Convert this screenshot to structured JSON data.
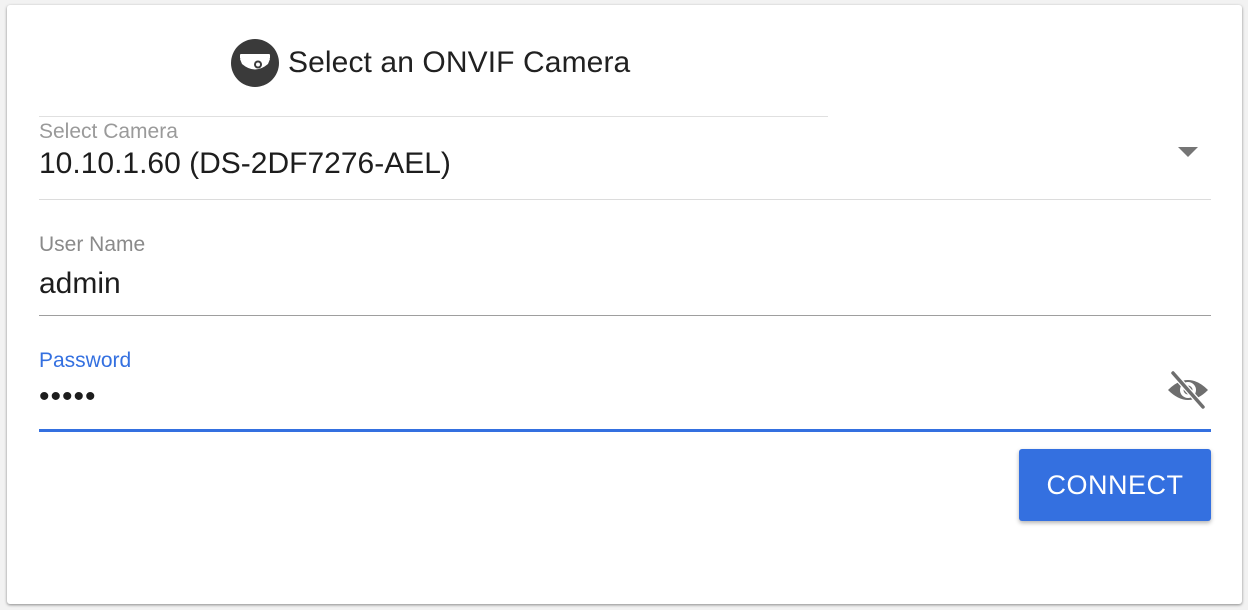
{
  "header": {
    "title": "Select an ONVIF Camera",
    "icon": "dome-camera-icon"
  },
  "camera_select": {
    "label": "Select Camera",
    "value": "10.10.1.60 (DS-2DF7276-AEL)",
    "icon": "chevron-down-icon"
  },
  "username": {
    "label": "User Name",
    "value": "admin"
  },
  "password": {
    "label": "Password",
    "value": "•••••",
    "toggle_icon": "eye-off-icon"
  },
  "actions": {
    "connect_label": "CONNECT"
  },
  "colors": {
    "accent": "#3470e0",
    "text": "#212121",
    "label": "#8a8a8a"
  }
}
